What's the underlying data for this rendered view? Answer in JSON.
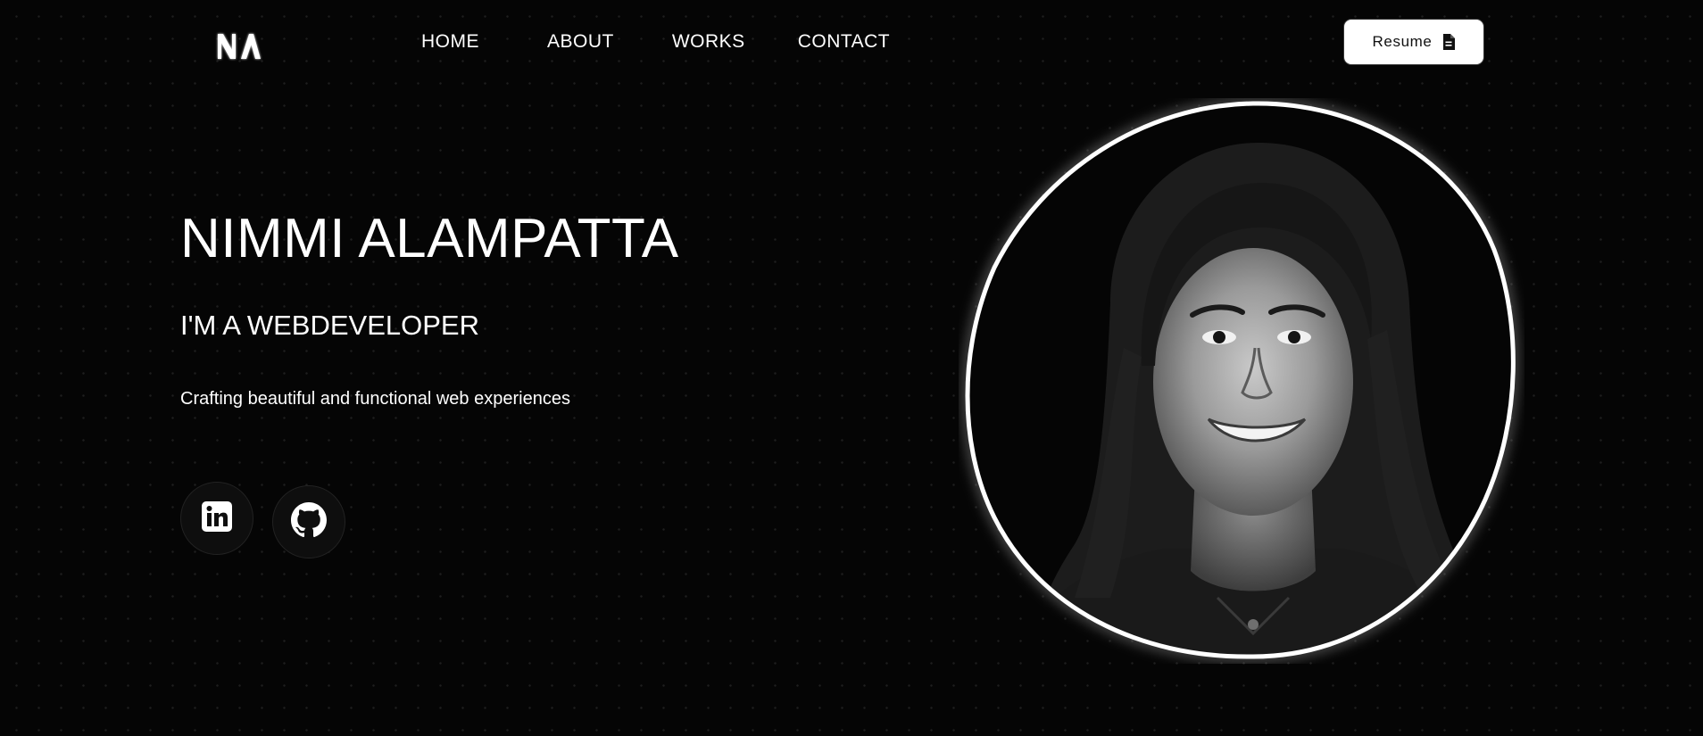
{
  "header": {
    "logo_icon": "na-monogram-logo",
    "nav": [
      {
        "label": "HOME"
      },
      {
        "label": "ABOUT"
      },
      {
        "label": "WORKS"
      },
      {
        "label": "CONTACT"
      }
    ],
    "resume": {
      "label": "Resume",
      "icon": "document-icon"
    }
  },
  "hero": {
    "name": "NIMMI ALAMPATTA",
    "role": "I'M A WEBDEVELOPER",
    "tagline": "Crafting beautiful and functional web experiences",
    "portrait_icon": "portrait-photo"
  },
  "social": [
    {
      "icon": "linkedin-icon"
    },
    {
      "icon": "github-icon"
    }
  ],
  "colors": {
    "background": "#050505",
    "text": "#ffffff",
    "button_bg": "#ffffff",
    "button_text": "#111111",
    "social_bg": "#0e0e0e"
  }
}
